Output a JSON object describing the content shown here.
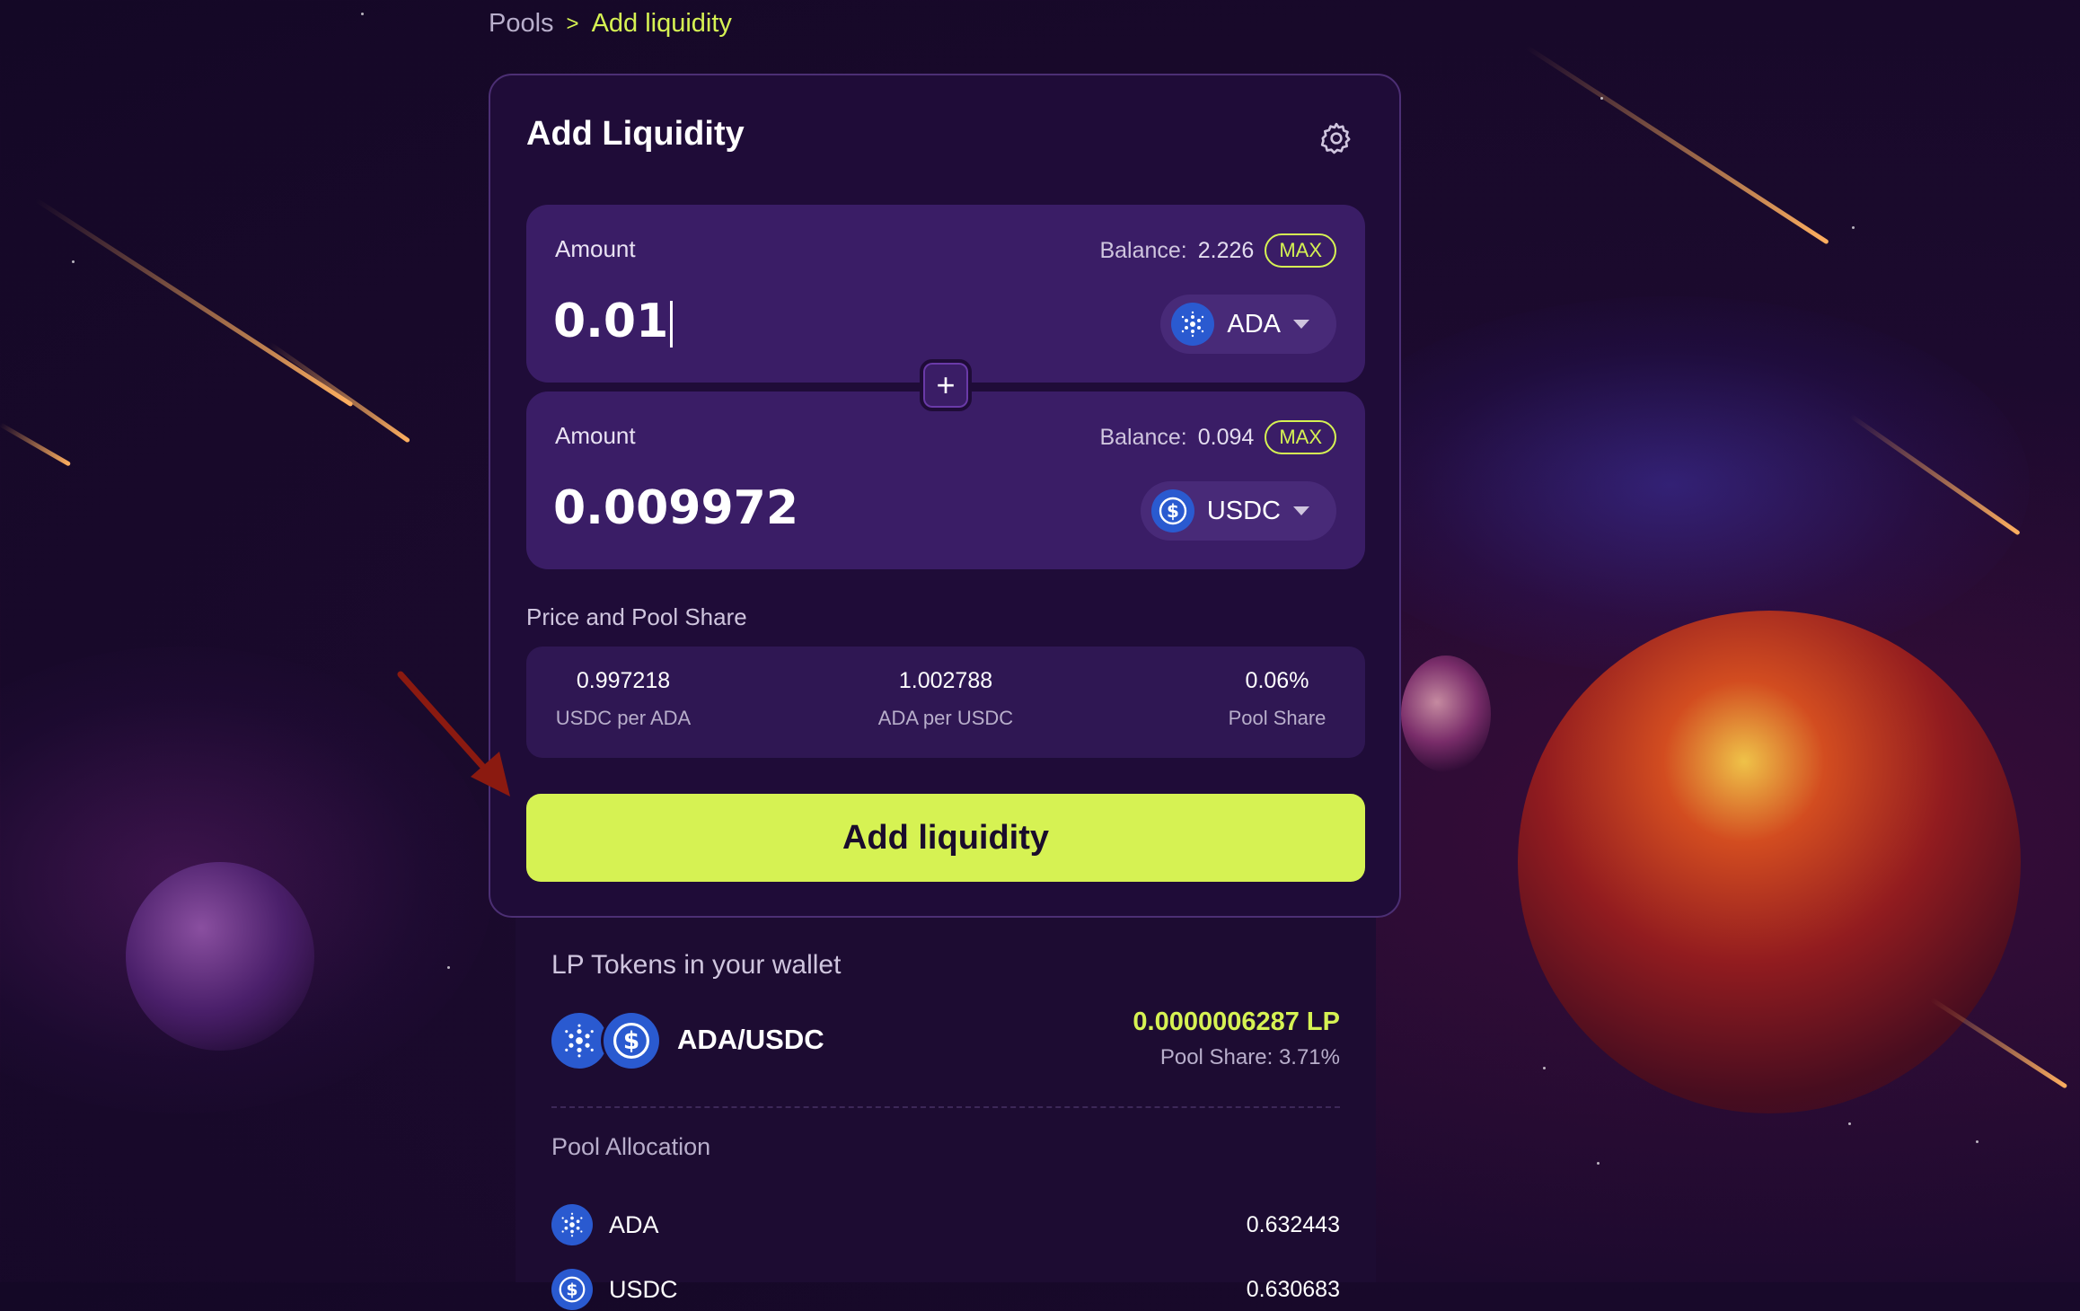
{
  "breadcrumb": {
    "parent": "Pools",
    "separator": ">",
    "current": "Add liquidity"
  },
  "card": {
    "title": "Add Liquidity",
    "settings_icon": "gear-icon"
  },
  "inputs": [
    {
      "label": "Amount",
      "balance_label": "Balance:",
      "balance": "2.226",
      "max_label": "MAX",
      "amount": "0.01",
      "token": "ADA",
      "token_icon": "ada-icon"
    },
    {
      "label": "Amount",
      "balance_label": "Balance:",
      "balance": "0.094",
      "max_label": "MAX",
      "amount": "0.009972",
      "token": "USDC",
      "token_icon": "usdc-icon"
    }
  ],
  "plus_symbol": "+",
  "price_share": {
    "label": "Price and Pool Share",
    "stats": [
      {
        "value": "0.997218",
        "label": "USDC per ADA"
      },
      {
        "value": "1.002788",
        "label": "ADA per USDC"
      },
      {
        "value": "0.06%",
        "label": "Pool Share"
      }
    ]
  },
  "submit_label": "Add liquidity",
  "lp": {
    "title": "LP Tokens in your wallet",
    "pair": "ADA/USDC",
    "amount": "0.0000006287 LP",
    "share_label": "Pool Share:",
    "share_value": "3.71%",
    "allocation_title": "Pool Allocation",
    "allocation": [
      {
        "token": "ADA",
        "value": "0.632443"
      },
      {
        "token": "USDC",
        "value": "0.630683"
      }
    ]
  },
  "colors": {
    "accent": "#d6f253",
    "card": "#1f0c38",
    "field": "#3a1d66",
    "token_blue": "#2a5ad0",
    "arrow": "#8b1a10"
  }
}
